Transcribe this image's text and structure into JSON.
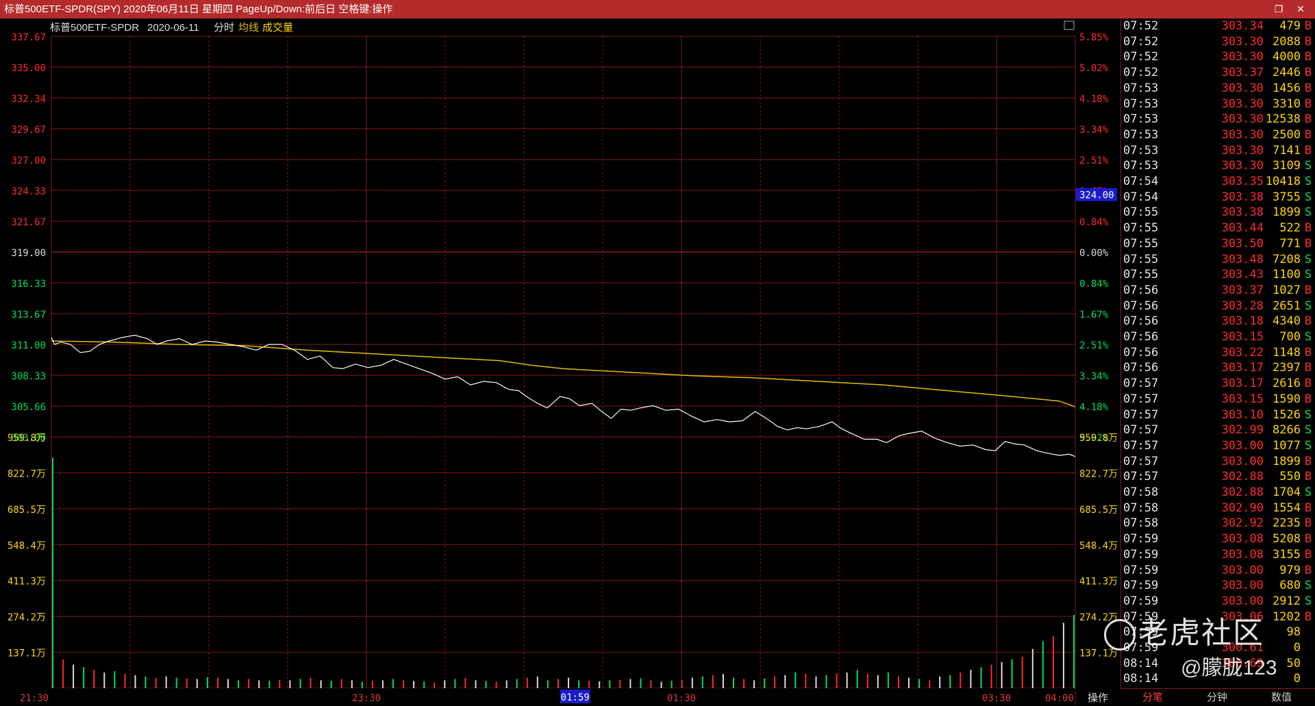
{
  "window": {
    "title": "标普500ETF-SPDR(SPY) 2020年06月11日 星期四 PageUp/Down:前后日 空格键:操作",
    "controls": [
      "restore-icon",
      "close-icon"
    ]
  },
  "chart_header": {
    "name": "标普500ETF-SPDR",
    "date": "2020-06-11",
    "mode": "分时",
    "avg_label": "均线",
    "vol_label": "成交量"
  },
  "colors": {
    "up": "#ff2b2b",
    "down": "#00e05a",
    "grid": "#8a1a1a",
    "price_line": "#ffffff",
    "avg_line": "#e0c000",
    "volume": "#ffd700",
    "buy": "#ff2b2b",
    "sell": "#00e05a"
  },
  "cursor_price": "324.00",
  "bottom_left": "操作",
  "cursor_time": "01:59",
  "chart_data": {
    "type": "line",
    "title": "标普500ETF-SPDR 2020-06-11 分时",
    "prev_close": 319.0,
    "price_ticks": [
      "337.67",
      "335.00",
      "332.34",
      "329.67",
      "327.00",
      "324.33",
      "321.67",
      "319.00",
      "316.33",
      "313.67",
      "311.00",
      "308.33",
      "305.66",
      "303.00"
    ],
    "pct_ticks": [
      "5.85%",
      "5.02%",
      "4.18%",
      "3.34%",
      "2.51%",
      "1.67%",
      "0.84%",
      "0.00%",
      "0.84%",
      "1.67%",
      "2.51%",
      "3.34%",
      "4.18%",
      "5.02%"
    ],
    "volume_ticks": [
      "959.8万",
      "822.7万",
      "685.5万",
      "548.4万",
      "411.3万",
      "274.2万",
      "137.1万"
    ],
    "x_ticks": [
      "21:30",
      "23:30",
      "01:30",
      "03:30",
      "04:00"
    ],
    "ylim": [
      303.0,
      337.67
    ],
    "volume_max": 959.8,
    "series": [
      {
        "name": "price",
        "points": [
          [
            0,
            311.6
          ],
          [
            2,
            311.0
          ],
          [
            6,
            311.2
          ],
          [
            12,
            311.0
          ],
          [
            18,
            310.3
          ],
          [
            24,
            310.4
          ],
          [
            30,
            311.0
          ],
          [
            36,
            311.3
          ],
          [
            44,
            311.6
          ],
          [
            52,
            311.8
          ],
          [
            60,
            311.5
          ],
          [
            66,
            311.0
          ],
          [
            72,
            311.3
          ],
          [
            80,
            311.5
          ],
          [
            88,
            311.0
          ],
          [
            96,
            311.3
          ],
          [
            104,
            311.2
          ],
          [
            112,
            311.0
          ],
          [
            120,
            310.8
          ],
          [
            128,
            310.5
          ],
          [
            136,
            311.0
          ],
          [
            144,
            311.0
          ],
          [
            152,
            310.5
          ],
          [
            160,
            309.7
          ],
          [
            168,
            310.0
          ],
          [
            176,
            309.0
          ],
          [
            182,
            308.9
          ],
          [
            190,
            309.3
          ],
          [
            198,
            309.0
          ],
          [
            206,
            309.2
          ],
          [
            214,
            309.7
          ],
          [
            222,
            309.3
          ],
          [
            230,
            308.9
          ],
          [
            238,
            308.5
          ],
          [
            246,
            308.0
          ],
          [
            254,
            308.2
          ],
          [
            262,
            307.5
          ],
          [
            270,
            307.8
          ],
          [
            278,
            307.7
          ],
          [
            286,
            307.1
          ],
          [
            292,
            307.0
          ],
          [
            298,
            306.4
          ],
          [
            304,
            305.9
          ],
          [
            310,
            305.5
          ],
          [
            318,
            306.5
          ],
          [
            324,
            306.3
          ],
          [
            330,
            305.7
          ],
          [
            338,
            305.9
          ],
          [
            344,
            305.2
          ],
          [
            350,
            304.6
          ],
          [
            356,
            305.4
          ],
          [
            362,
            305.3
          ],
          [
            368,
            305.5
          ],
          [
            376,
            305.7
          ],
          [
            384,
            305.3
          ],
          [
            392,
            305.4
          ],
          [
            400,
            304.8
          ],
          [
            408,
            304.3
          ],
          [
            416,
            304.5
          ],
          [
            424,
            304.3
          ],
          [
            432,
            304.4
          ],
          [
            440,
            305.2
          ],
          [
            448,
            304.5
          ],
          [
            454,
            303.9
          ],
          [
            460,
            303.6
          ],
          [
            466,
            303.8
          ],
          [
            472,
            303.7
          ],
          [
            480,
            303.9
          ],
          [
            488,
            304.3
          ],
          [
            494,
            303.7
          ],
          [
            500,
            303.3
          ],
          [
            508,
            302.8
          ],
          [
            516,
            302.8
          ],
          [
            522,
            302.5
          ],
          [
            530,
            303.1
          ],
          [
            536,
            303.3
          ],
          [
            544,
            303.5
          ],
          [
            552,
            302.9
          ],
          [
            560,
            302.5
          ],
          [
            568,
            302.2
          ],
          [
            576,
            302.3
          ],
          [
            584,
            301.9
          ],
          [
            590,
            301.8
          ],
          [
            596,
            302.6
          ],
          [
            602,
            302.4
          ],
          [
            608,
            302.3
          ],
          [
            616,
            301.8
          ],
          [
            622,
            301.6
          ],
          [
            630,
            301.4
          ],
          [
            636,
            301.5
          ],
          [
            640,
            301.3
          ]
        ]
      },
      {
        "name": "avg",
        "points": [
          [
            0,
            311.3
          ],
          [
            40,
            311.2
          ],
          [
            80,
            311.0
          ],
          [
            120,
            310.9
          ],
          [
            160,
            310.5
          ],
          [
            200,
            310.2
          ],
          [
            240,
            309.9
          ],
          [
            280,
            309.6
          ],
          [
            300,
            309.2
          ],
          [
            320,
            308.9
          ],
          [
            360,
            308.6
          ],
          [
            400,
            308.3
          ],
          [
            440,
            308.1
          ],
          [
            480,
            307.8
          ],
          [
            520,
            307.5
          ],
          [
            560,
            307.0
          ],
          [
            600,
            306.5
          ],
          [
            630,
            306.1
          ],
          [
            640,
            305.6
          ]
        ]
      },
      {
        "name": "volume",
        "values": [
          880,
          110,
          90,
          80,
          70,
          60,
          65,
          55,
          50,
          45,
          40,
          45,
          40,
          38,
          35,
          42,
          40,
          35,
          30,
          35,
          30,
          28,
          32,
          30,
          35,
          40,
          30,
          28,
          35,
          30,
          25,
          28,
          30,
          35,
          30,
          28,
          25,
          22,
          30,
          35,
          40,
          30,
          28,
          25,
          30,
          35,
          40,
          45,
          30,
          35,
          40,
          30,
          28,
          26,
          30,
          32,
          35,
          38,
          30,
          25,
          28,
          30,
          40,
          45,
          50,
          55,
          40,
          35,
          30,
          38,
          45,
          50,
          60,
          55,
          45,
          50,
          55,
          60,
          70,
          55,
          50,
          60,
          45,
          40,
          35,
          30,
          45,
          50,
          60,
          70,
          80,
          90,
          100,
          110,
          120,
          150,
          180,
          200,
          250,
          280
        ]
      }
    ]
  },
  "tick_list": [
    {
      "t": "07:52",
      "p": "303.34",
      "v": "479",
      "s": "B"
    },
    {
      "t": "07:52",
      "p": "303.30",
      "v": "2088",
      "s": "B"
    },
    {
      "t": "07:52",
      "p": "303.30",
      "v": "4000",
      "s": "B"
    },
    {
      "t": "07:52",
      "p": "303.37",
      "v": "2446",
      "s": "B"
    },
    {
      "t": "07:53",
      "p": "303.30",
      "v": "1456",
      "s": "B"
    },
    {
      "t": "07:53",
      "p": "303.30",
      "v": "3310",
      "s": "B"
    },
    {
      "t": "07:53",
      "p": "303.30",
      "v": "12538",
      "s": "B"
    },
    {
      "t": "07:53",
      "p": "303.30",
      "v": "2500",
      "s": "B"
    },
    {
      "t": "07:53",
      "p": "303.30",
      "v": "7141",
      "s": "B"
    },
    {
      "t": "07:53",
      "p": "303.30",
      "v": "3109",
      "s": "S"
    },
    {
      "t": "07:54",
      "p": "303.35",
      "v": "10418",
      "s": "S"
    },
    {
      "t": "07:54",
      "p": "303.38",
      "v": "3755",
      "s": "S"
    },
    {
      "t": "07:55",
      "p": "303.38",
      "v": "1899",
      "s": "S"
    },
    {
      "t": "07:55",
      "p": "303.44",
      "v": "522",
      "s": "B"
    },
    {
      "t": "07:55",
      "p": "303.50",
      "v": "771",
      "s": "B"
    },
    {
      "t": "07:55",
      "p": "303.48",
      "v": "7208",
      "s": "S"
    },
    {
      "t": "07:55",
      "p": "303.43",
      "v": "1100",
      "s": "S"
    },
    {
      "t": "07:56",
      "p": "303.37",
      "v": "1027",
      "s": "B"
    },
    {
      "t": "07:56",
      "p": "303.28",
      "v": "2651",
      "s": "S"
    },
    {
      "t": "07:56",
      "p": "303.18",
      "v": "4340",
      "s": "B"
    },
    {
      "t": "07:56",
      "p": "303.15",
      "v": "700",
      "s": "S"
    },
    {
      "t": "07:56",
      "p": "303.22",
      "v": "1148",
      "s": "B"
    },
    {
      "t": "07:56",
      "p": "303.17",
      "v": "2397",
      "s": "B"
    },
    {
      "t": "07:57",
      "p": "303.17",
      "v": "2616",
      "s": "B"
    },
    {
      "t": "07:57",
      "p": "303.15",
      "v": "1590",
      "s": "B"
    },
    {
      "t": "07:57",
      "p": "303.10",
      "v": "1526",
      "s": "S"
    },
    {
      "t": "07:57",
      "p": "302.99",
      "v": "8266",
      "s": "S"
    },
    {
      "t": "07:57",
      "p": "303.00",
      "v": "1077",
      "s": "S"
    },
    {
      "t": "07:57",
      "p": "303.00",
      "v": "1899",
      "s": "B"
    },
    {
      "t": "07:57",
      "p": "302.88",
      "v": "550",
      "s": "B"
    },
    {
      "t": "07:58",
      "p": "302.88",
      "v": "1704",
      "s": "S"
    },
    {
      "t": "07:58",
      "p": "302.90",
      "v": "1554",
      "s": "B"
    },
    {
      "t": "07:58",
      "p": "302.92",
      "v": "2235",
      "s": "B"
    },
    {
      "t": "07:59",
      "p": "303.08",
      "v": "5208",
      "s": "B"
    },
    {
      "t": "07:59",
      "p": "303.08",
      "v": "3155",
      "s": "B"
    },
    {
      "t": "07:59",
      "p": "303.00",
      "v": "979",
      "s": "B"
    },
    {
      "t": "07:59",
      "p": "303.00",
      "v": "680",
      "s": "S"
    },
    {
      "t": "07:59",
      "p": "303.00",
      "v": "2912",
      "s": "S"
    },
    {
      "t": "07:59",
      "p": "303.06",
      "v": "1202",
      "s": "B"
    },
    {
      "t": "07:59",
      "p": "",
      "v": "98",
      "s": ""
    },
    {
      "t": "07:59",
      "p": "300.61",
      "v": "0",
      "s": ""
    },
    {
      "t": "08:14",
      "p": "300.69",
      "v": "50",
      "s": ""
    },
    {
      "t": "08:14",
      "p": "",
      "v": "0",
      "s": ""
    }
  ],
  "bottom_tabs": [
    "分笔",
    "分钟",
    "数值"
  ],
  "watermark": {
    "logo": "老虎社区",
    "user": "@朦胧123"
  }
}
